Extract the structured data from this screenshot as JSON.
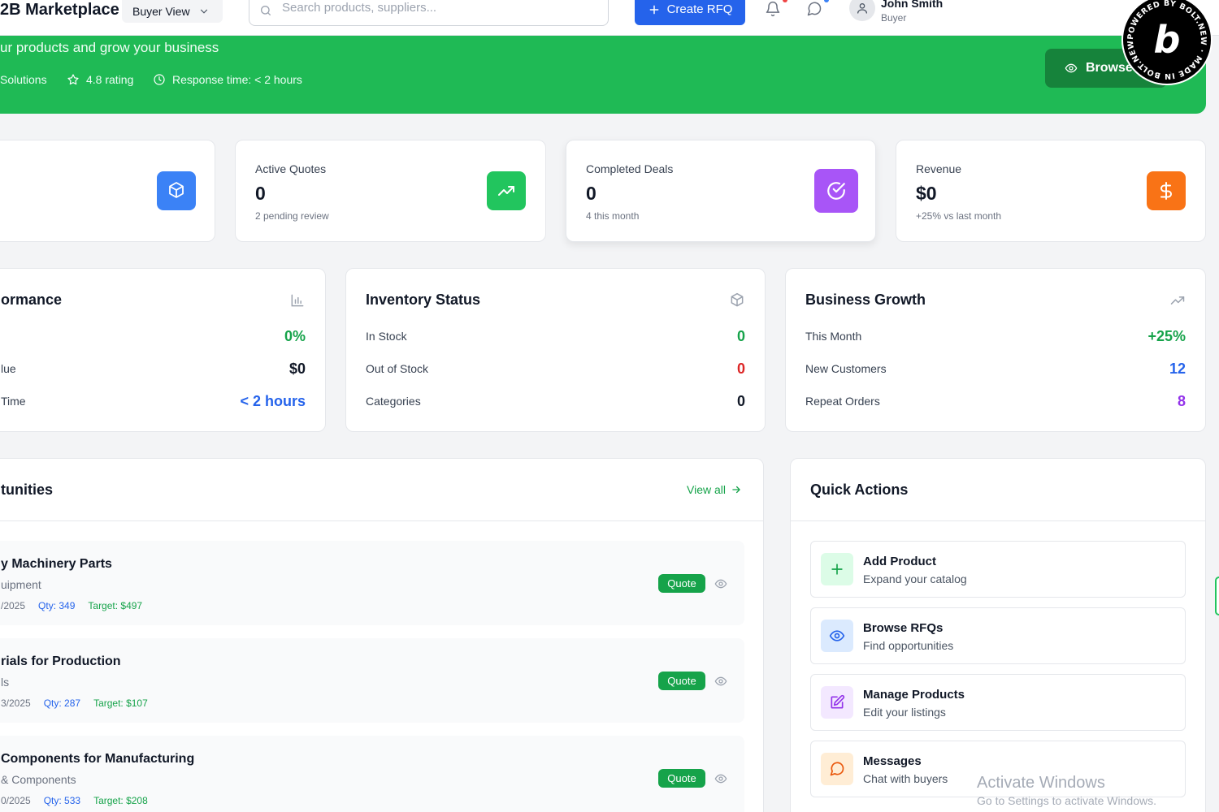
{
  "header": {
    "brand": "2B Marketplace",
    "view_switch": "Buyer View",
    "search_placeholder": "Search products, suppliers...",
    "create_rfq": "Create RFQ",
    "user_name": "John Smith",
    "user_role": "Buyer"
  },
  "banner": {
    "subtitle": "ur products and grow your business",
    "company": "Solutions",
    "rating": "4.8 rating",
    "response": "Response time: < 2 hours",
    "browse_button": "Browse"
  },
  "stats": [
    {
      "label": "",
      "value": "",
      "sub": "",
      "icon": "box-icon",
      "color": "#3b82f6"
    },
    {
      "label": "Active Quotes",
      "value": "0",
      "sub": "2 pending review",
      "icon": "trending-up-icon",
      "color": "#22c55e"
    },
    {
      "label": "Completed Deals",
      "value": "0",
      "sub": "4 this month",
      "icon": "check-circle-icon",
      "color": "#a855f7"
    },
    {
      "label": "Revenue",
      "value": "$0",
      "sub": "+25% vs last month",
      "icon": "dollar-icon",
      "color": "#f97316"
    }
  ],
  "performance": {
    "title": "ormance",
    "rows": [
      {
        "label": "",
        "value": "0%",
        "color": "#16a34a"
      },
      {
        "label": "lue",
        "value": "$0",
        "color": "#111827"
      },
      {
        "label": "Time",
        "value": "< 2 hours",
        "color": "#2563eb"
      }
    ]
  },
  "inventory": {
    "title": "Inventory Status",
    "rows": [
      {
        "label": "In Stock",
        "value": "0",
        "color": "#16a34a"
      },
      {
        "label": "Out of Stock",
        "value": "0",
        "color": "#dc2626"
      },
      {
        "label": "Categories",
        "value": "0",
        "color": "#111827"
      }
    ]
  },
  "growth": {
    "title": "Business Growth",
    "rows": [
      {
        "label": "This Month",
        "value": "+25%",
        "color": "#16a34a"
      },
      {
        "label": "New Customers",
        "value": "12",
        "color": "#2563eb"
      },
      {
        "label": "Repeat Orders",
        "value": "8",
        "color": "#9333ea"
      }
    ]
  },
  "opportunities": {
    "title": "tunities",
    "view_all": "View all",
    "items": [
      {
        "title": "y Machinery Parts",
        "category": "uipment",
        "date": "/2025",
        "qty": "Qty: 349",
        "target": "Target: $497",
        "badge": "Quote"
      },
      {
        "title": "rials for Production",
        "category": "ls",
        "date": "3/2025",
        "qty": "Qty: 287",
        "target": "Target: $107",
        "badge": "Quote"
      },
      {
        "title": "Components for Manufacturing",
        "category": "& Components",
        "date": "0/2025",
        "qty": "Qty: 533",
        "target": "Target: $208",
        "badge": "Quote"
      }
    ]
  },
  "quick_actions": {
    "title": "Quick Actions",
    "items": [
      {
        "title": "Add Product",
        "sub": "Expand your catalog",
        "icon": "plus-icon",
        "bg": "#dcfce7",
        "color": "#16a34a"
      },
      {
        "title": "Browse RFQs",
        "sub": "Find opportunities",
        "icon": "eye-icon",
        "bg": "#dbeafe",
        "color": "#2563eb"
      },
      {
        "title": "Manage Products",
        "sub": "Edit your listings",
        "icon": "edit-icon",
        "bg": "#f3e8ff",
        "color": "#9333ea"
      },
      {
        "title": "Messages",
        "sub": "Chat with buyers",
        "icon": "message-icon",
        "bg": "#ffedd5",
        "color": "#ea580c"
      }
    ]
  },
  "watermark": {
    "title": "Activate Windows",
    "sub": "Go to Settings to activate Windows."
  },
  "badge_text": "POWERED BY BOLT.NEW · MADE IN BOLT.NEW ·"
}
